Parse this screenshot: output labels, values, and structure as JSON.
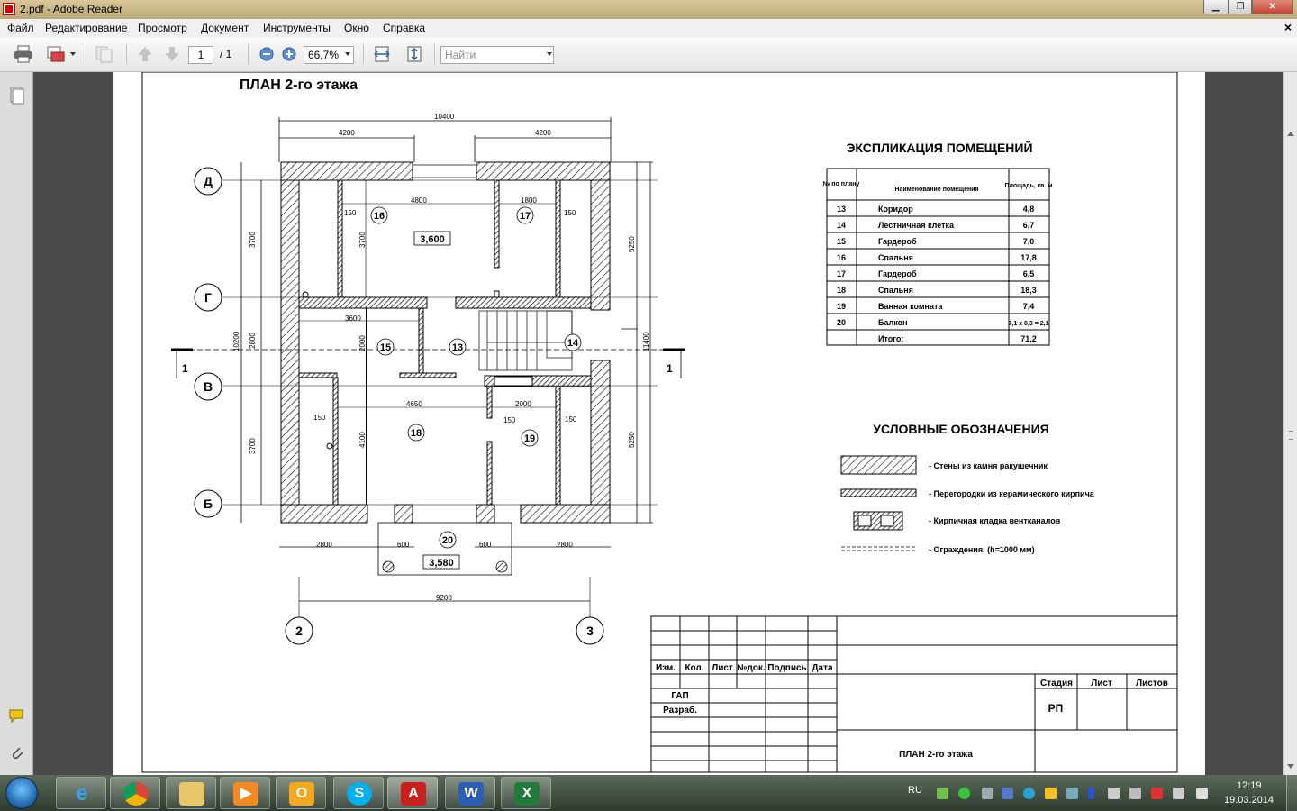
{
  "window": {
    "title": "2.pdf - Adobe Reader"
  },
  "menu": [
    "Файл",
    "Редактирование",
    "Просмотр",
    "Документ",
    "Инструменты",
    "Окно",
    "Справка"
  ],
  "toolbar": {
    "page_current": "1",
    "page_total": "/ 1",
    "zoom": "66,7%",
    "search_placeholder": "Найти"
  },
  "drawing": {
    "plan_title": "ПЛАН 2-го этажа",
    "dims_top": {
      "total": "10400",
      "left": "4200",
      "right": "4200"
    },
    "dims_inner": {
      "d1": "4800",
      "d2": "1800",
      "d3": "3600",
      "d4": "4650",
      "d5": "2000",
      "p150a": "150",
      "p150b": "150",
      "p150c": "150",
      "p150d": "150",
      "p150e": "150",
      "v3700a": "3700",
      "v2000": "2000",
      "v4100": "4100"
    },
    "dims_left": {
      "a": "3700",
      "b": "2800",
      "c": "3700",
      "total": "10200"
    },
    "dims_right": {
      "a": "5250",
      "b": "5250",
      "total": "11400"
    },
    "dims_bottom": {
      "a": "2800",
      "b": "600",
      "c": "600",
      "d": "2800",
      "total": "9200"
    },
    "axes": {
      "d": "Д",
      "g": "Г",
      "v": "В",
      "b": "Б",
      "ax2": "2",
      "ax3": "3"
    },
    "section": {
      "left": "1",
      "right": "1"
    },
    "rooms": {
      "r13": "13",
      "r14": "14",
      "r15": "15",
      "r16": "16",
      "r17": "17",
      "r18": "18",
      "r19": "19",
      "r20": "20"
    },
    "levels": {
      "floor": "3,600",
      "balcony": "3,580"
    }
  },
  "explication": {
    "title": "ЭКСПЛИКАЦИЯ  ПОМЕЩЕНИЙ",
    "headers": [
      "№ по плану",
      "Наименование помещения",
      "Площадь, кв. м"
    ],
    "rows": [
      {
        "n": "13",
        "name": "Коридор",
        "area": "4,8"
      },
      {
        "n": "14",
        "name": "Лестничная клетка",
        "area": "6,7"
      },
      {
        "n": "15",
        "name": "Гардероб",
        "area": "7,0"
      },
      {
        "n": "16",
        "name": "Спальня",
        "area": "17,8"
      },
      {
        "n": "17",
        "name": "Гардероб",
        "area": "6,5"
      },
      {
        "n": "18",
        "name": "Спальня",
        "area": "18,3"
      },
      {
        "n": "19",
        "name": "Ванная комната",
        "area": "7,4"
      },
      {
        "n": "20",
        "name": "Балкон",
        "area": "7,1 х 0,3 = 2,1"
      },
      {
        "n": "",
        "name": "Итого:",
        "area": "71,2"
      }
    ]
  },
  "legend": {
    "title": "УСЛОВНЫЕ ОБОЗНАЧЕНИЯ",
    "items": [
      "- Стены из камня ракушечник",
      "- Перегородки из керамического кирпича",
      "- Кирпичная кладка вентканалов",
      "- Ограждения, (h=1000 мм)"
    ]
  },
  "stamp": {
    "cols": [
      "Изм.",
      "Кол.",
      "Лист",
      "№док.",
      "Подпись",
      "Дата"
    ],
    "gap": "ГАП",
    "razrab": "Разраб.",
    "stage_h": "Стадия",
    "sheet_h": "Лист",
    "sheets_h": "Листов",
    "stage": "РП",
    "sheet_title": "ПЛАН 2-го этажа"
  },
  "taskbar": {
    "lang": "RU",
    "time": "12:19",
    "date": "19.03.2014"
  },
  "colors": {
    "wall_hatch": "#000000",
    "window_titlebar": "#c7b585",
    "viewer_bg": "#4b4b4b"
  }
}
